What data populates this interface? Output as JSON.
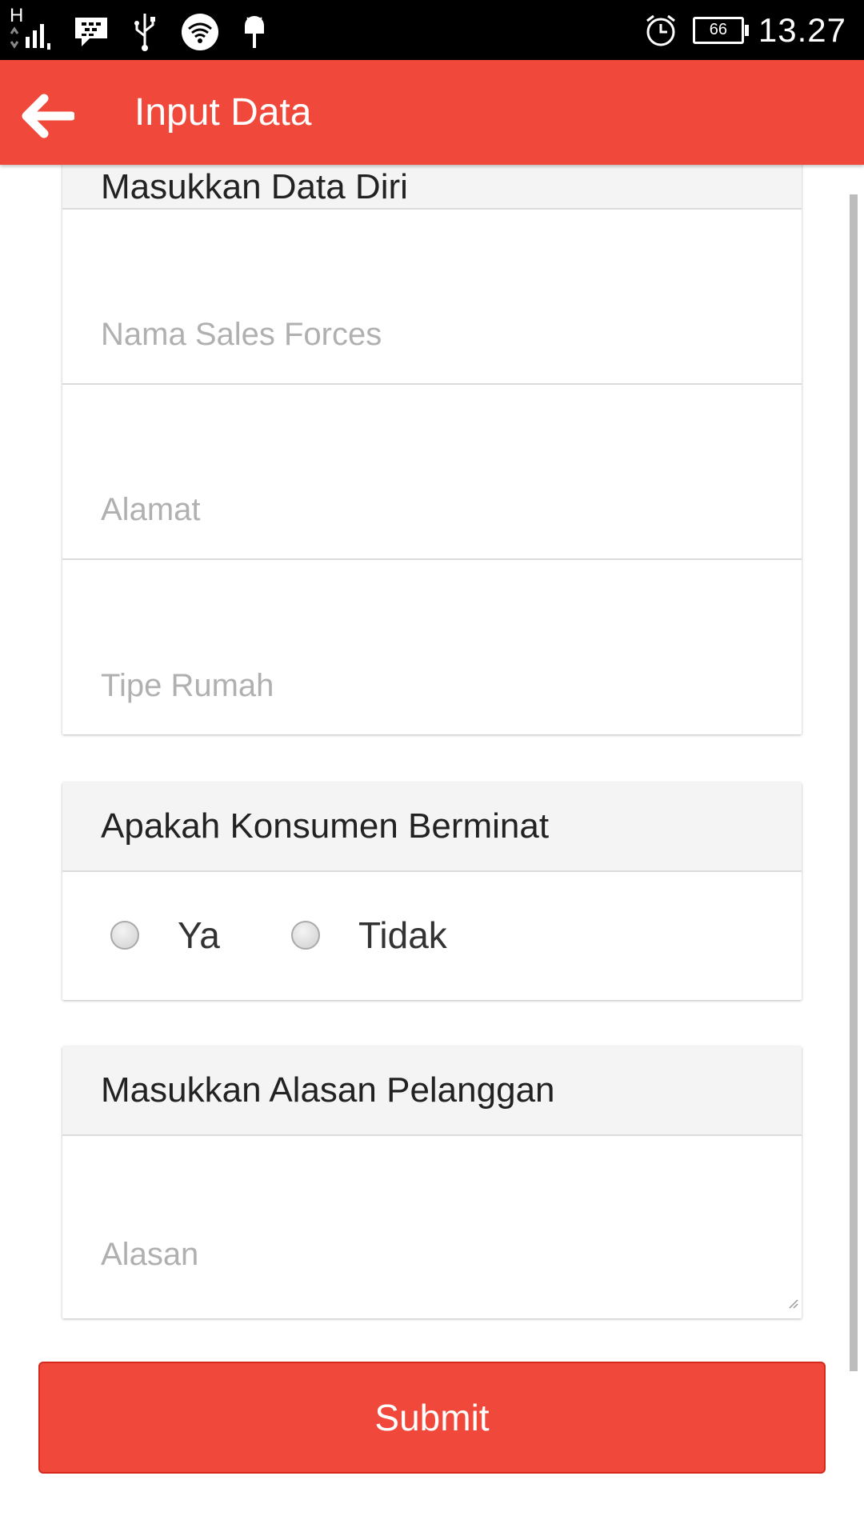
{
  "status_bar": {
    "network_label": "H",
    "time": "13.27",
    "battery": "66",
    "icons": [
      "signal-icon",
      "bbm-icon",
      "usb-icon",
      "wifi-icon",
      "android-icon",
      "alarm-icon",
      "battery-icon"
    ]
  },
  "app_bar": {
    "title": "Input Data",
    "back_icon": "arrow-left-icon",
    "color": "#f0493b"
  },
  "form_data_diri": {
    "header": "Masukkan Data Diri",
    "fields": [
      {
        "placeholder": "Nama Sales Forces",
        "value": ""
      },
      {
        "placeholder": "Alamat",
        "value": ""
      },
      {
        "placeholder": "Tipe Rumah",
        "value": ""
      }
    ]
  },
  "form_minat": {
    "header": "Apakah Konsumen Berminat",
    "options": [
      {
        "label": "Ya",
        "selected": false
      },
      {
        "label": "Tidak",
        "selected": false
      }
    ]
  },
  "form_alasan": {
    "header": "Masukkan Alasan Pelanggan",
    "placeholder": "Alasan",
    "value": ""
  },
  "submit": {
    "label": "Submit"
  }
}
